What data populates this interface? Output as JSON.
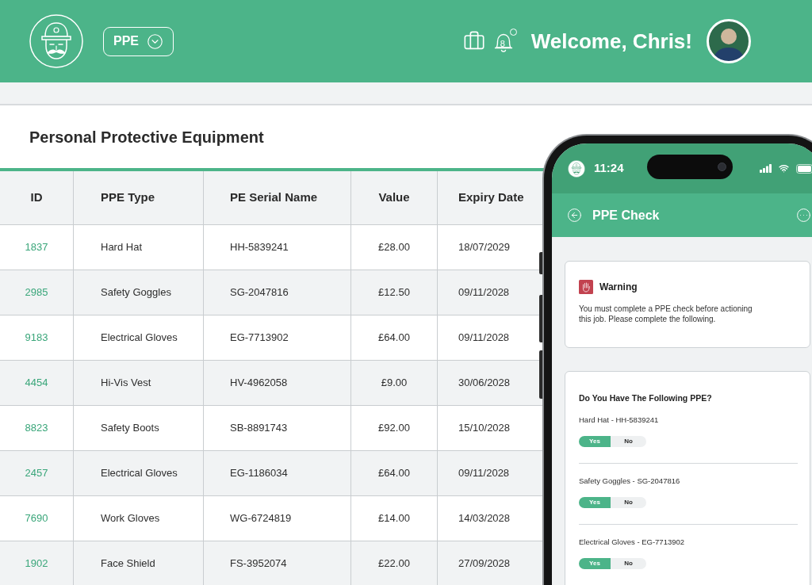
{
  "header": {
    "menu_button": {
      "label": "PPE"
    },
    "notifications": {
      "count": "8"
    },
    "greeting": "Welcome, Chris!"
  },
  "page": {
    "title": "Personal Protective Equipment"
  },
  "table": {
    "columns": [
      "ID",
      "PPE Type",
      "PE Serial Name",
      "Value",
      "Expiry Date"
    ],
    "rows": [
      [
        "1837",
        "Hard Hat",
        "HH-5839241",
        "£28.00",
        "18/07/2029"
      ],
      [
        "2985",
        "Safety Goggles",
        "SG-2047816",
        "£12.50",
        "09/11/2028"
      ],
      [
        "9183",
        "Electrical Gloves",
        "EG-7713902",
        "£64.00",
        "09/11/2028"
      ],
      [
        "4454",
        "Hi-Vis Vest",
        "HV-4962058",
        "£9.00",
        "30/06/2028"
      ],
      [
        "8823",
        "Safety Boots",
        "SB-8891743",
        "£92.00",
        "15/10/2028"
      ],
      [
        "2457",
        "Electrical Gloves",
        "EG-1186034",
        "£64.00",
        "09/11/2028"
      ],
      [
        "7690",
        "Work Gloves",
        "WG-6724819",
        "£14.00",
        "14/03/2028"
      ],
      [
        "1902",
        "Face Shield",
        "FS-3952074",
        "£22.00",
        "27/09/2028"
      ]
    ]
  },
  "phone": {
    "status_bar": {
      "time": "11:24"
    },
    "app_bar": {
      "title": "PPE Check"
    },
    "warning": {
      "title": "Warning",
      "message": "You must complete a PPE check before actioning this job. Please complete the following."
    },
    "checklist": {
      "title": "Do You Have The Following PPE?",
      "items": [
        {
          "label": "Hard Hat - HH-5839241",
          "options": [
            {
              "label": "Yes",
              "selected": true
            },
            {
              "label": "No",
              "selected": false
            }
          ]
        },
        {
          "label": "Safety Goggles - SG-2047816",
          "options": [
            {
              "label": "Yes",
              "selected": true
            },
            {
              "label": "No",
              "selected": false
            }
          ]
        },
        {
          "label": "Electrical Gloves - EG-7713902",
          "options": [
            {
              "label": "Yes",
              "selected": true
            },
            {
              "label": "No",
              "selected": false
            }
          ]
        }
      ]
    }
  }
}
